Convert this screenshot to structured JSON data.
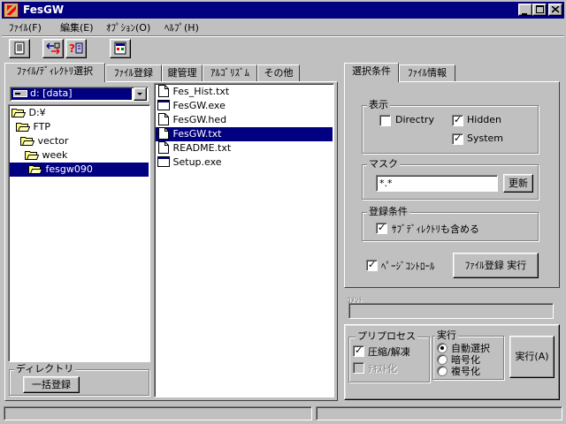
{
  "window": {
    "title": "FesGW"
  },
  "menu": [
    "ﾌｧｲﾙ(F)",
    "編集(E)",
    "ｵﾌﾟｼｮﾝ(O)",
    "ﾍﾙﾌﾟ(H)"
  ],
  "left_tabs": [
    "ﾌｧｲﾙ/ﾃﾞｨﾚｸﾄﾘ選択",
    "ﾌｧｲﾙ登録",
    "鍵管理",
    "ｱﾙｺﾞﾘｽﾞﾑ",
    "その他"
  ],
  "drive": {
    "selected": "d: [data]"
  },
  "tree": [
    {
      "label": "D:¥",
      "indent": 0
    },
    {
      "label": "FTP",
      "indent": 1
    },
    {
      "label": "vector",
      "indent": 2
    },
    {
      "label": "week",
      "indent": 3
    },
    {
      "label": "fesgw090",
      "indent": 4,
      "selected": true
    }
  ],
  "files": [
    {
      "name": "Fes_Hist.txt",
      "icon": "document-icon"
    },
    {
      "name": "FesGW.exe",
      "icon": "exe-icon"
    },
    {
      "name": "FesGW.hed",
      "icon": "document-icon"
    },
    {
      "name": "FesGW.txt",
      "icon": "document-icon",
      "selected": true
    },
    {
      "name": "README.txt",
      "icon": "document-icon"
    },
    {
      "name": "Setup.exe",
      "icon": "exe-icon"
    }
  ],
  "directory_group": {
    "label": "ディレクトリ",
    "button": "一括登録"
  },
  "right_tabs": [
    "選択条件",
    "ﾌｧｲﾙ情報"
  ],
  "display_group": {
    "label": "表示",
    "directry": {
      "label": "Directry",
      "checked": false
    },
    "hidden": {
      "label": "Hidden",
      "checked": true
    },
    "system": {
      "label": "System",
      "checked": true
    }
  },
  "mask_group": {
    "label": "マスク",
    "value": "*.*",
    "update_button": "更新"
  },
  "register_group": {
    "label": "登録条件",
    "subdir": {
      "label": "ｻﾌﾞﾃﾞｨﾚｸﾄﾘも含める",
      "checked": true
    }
  },
  "page_control": {
    "label": "ﾍﾟｰｼﾞｺﾝﾄﾛｰﾙ",
    "checked": true
  },
  "register_exec_button": "ﾌｧｲﾙ登録 実行",
  "comment_label": "ｺﾒﾝﾄ",
  "preprocess_group": {
    "label": "プリプロセス",
    "compress": {
      "label": "圧縮/解凍",
      "checked": true
    },
    "textify": {
      "label": "ﾃｷｽﾄ化",
      "checked": false,
      "disabled": true
    }
  },
  "execute_group": {
    "label": "実行",
    "options": [
      "自動選択",
      "暗号化",
      "複号化"
    ],
    "selected_index": 0
  },
  "run_button": "実行(A)"
}
